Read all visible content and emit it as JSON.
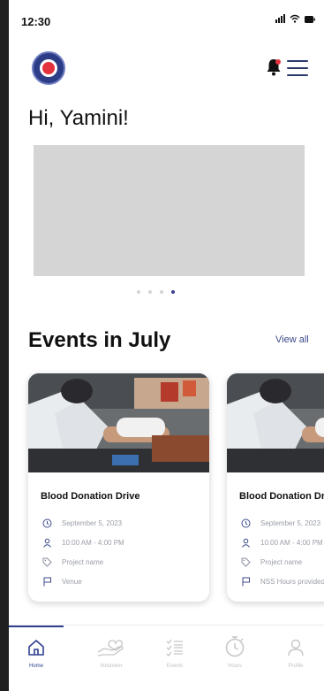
{
  "status_bar": {
    "time": "12:30",
    "icons": [
      "signal-icon",
      "wifi-icon",
      "battery-icon"
    ]
  },
  "header": {
    "logo_icon": "nss-logo",
    "notifications_icon": "bell-icon",
    "menu_icon": "hamburger-icon"
  },
  "greeting": "Hi, Yamini!",
  "carousel": {
    "slide_count": 4,
    "active_index": 3
  },
  "events_section": {
    "title": "Events in July",
    "view_all": "View all"
  },
  "events": [
    {
      "title": "Blood Donation Drive",
      "details": [
        {
          "icon": "clock-icon",
          "text": "September 5, 2023"
        },
        {
          "icon": "person-icon",
          "text": "10:00 AM - 4:00 PM"
        },
        {
          "icon": "tag-icon",
          "text": "Project name"
        },
        {
          "icon": "flag-icon",
          "text": "Venue"
        }
      ]
    },
    {
      "title": "Blood Donation Drive",
      "details": [
        {
          "icon": "clock-icon",
          "text": "September 5, 2023"
        },
        {
          "icon": "person-icon",
          "text": "10:00 AM - 4:00 PM"
        },
        {
          "icon": "tag-icon",
          "text": "Project name"
        },
        {
          "icon": "flag-icon",
          "text": "NSS Hours provided"
        }
      ]
    }
  ],
  "tab_bar": {
    "active_index": 0,
    "tabs": [
      {
        "label": "Home",
        "icon": "home-icon"
      },
      {
        "label": "Volunteer",
        "icon": "volunteer-hands-icon"
      },
      {
        "label": "Events",
        "icon": "list-checks-icon"
      },
      {
        "label": "Hours",
        "icon": "stopwatch-icon"
      },
      {
        "label": "Profile",
        "icon": "person-icon"
      }
    ]
  },
  "colors": {
    "primary": "#2f3f8f",
    "banner_placeholder": "#d5d5d5",
    "muted_text": "#9a9ea8",
    "logo_red": "#e3313d"
  }
}
